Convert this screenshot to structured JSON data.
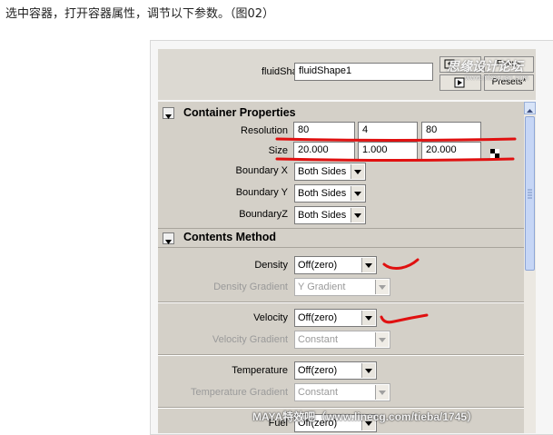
{
  "caption": "选中容器，打开容器属性，调节以下参数。（图02）",
  "header": {
    "shape_label": "fluidShape:",
    "shape_value": "fluidShape1",
    "focus_label": "Focus",
    "presets_label": "Presets*",
    "watermark_logo": "思缘设计论坛",
    "watermark_url": "www.missyuan.com"
  },
  "container_properties": {
    "title": "Container Properties",
    "resolution": {
      "label": "Resolution",
      "values": [
        "80",
        "4",
        "80"
      ]
    },
    "size": {
      "label": "Size",
      "values": [
        "20.000",
        "1.000",
        "20.000"
      ]
    },
    "boundary_x": {
      "label": "Boundary X",
      "value": "Both Sides"
    },
    "boundary_y": {
      "label": "Boundary Y",
      "value": "Both Sides"
    },
    "boundary_z": {
      "label": "BoundaryZ",
      "value": "Both Sides"
    }
  },
  "contents_method": {
    "title": "Contents Method",
    "density": {
      "label": "Density",
      "value": "Off(zero)"
    },
    "density_gradient": {
      "label": "Density Gradient",
      "value": "Y Gradient"
    },
    "velocity": {
      "label": "Velocity",
      "value": "Off(zero)"
    },
    "velocity_gradient": {
      "label": "Velocity Gradient",
      "value": "Constant"
    },
    "temperature": {
      "label": "Temperature",
      "value": "Off(zero)"
    },
    "temperature_gradient": {
      "label": "Temperature Gradient",
      "value": "Constant"
    },
    "fuel": {
      "label": "Fuel",
      "value": "Off(zero)"
    }
  },
  "footer_watermark": "MAYA特效吧（www.linecg.com/tieba/1745）",
  "colors": {
    "annotation": "#e01010",
    "panel": "#d4d0c8"
  }
}
